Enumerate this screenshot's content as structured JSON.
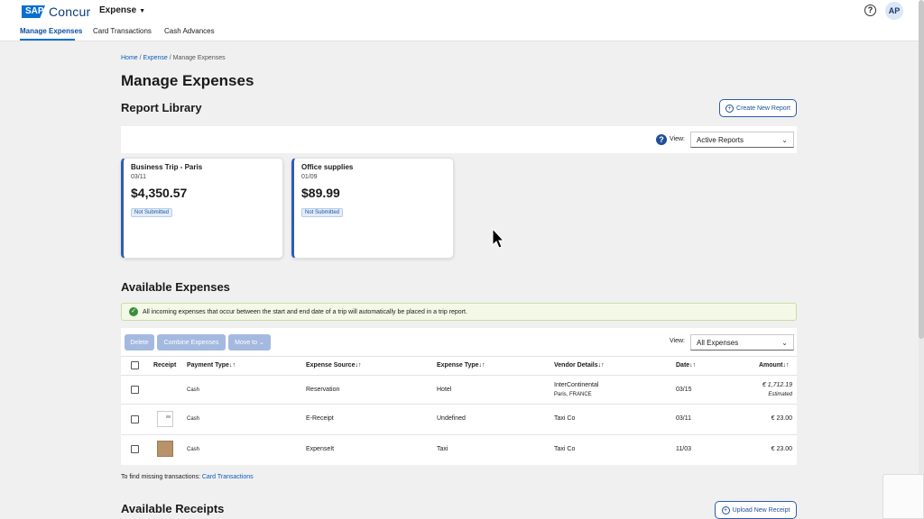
{
  "header": {
    "logo_sap": "SAP",
    "logo_concur": "Concur",
    "app_menu": "Expense",
    "help": "?",
    "avatar": "AP",
    "tabs": [
      {
        "label": "Manage Expenses"
      },
      {
        "label": "Card Transactions"
      },
      {
        "label": "Cash Advances"
      }
    ]
  },
  "breadcrumb": {
    "home": "Home",
    "sep1": " / ",
    "expense": "Expense",
    "sep2": " / ",
    "current": "Manage Expenses"
  },
  "page_title": "Manage Expenses",
  "report_library": {
    "title": "Report Library",
    "create_button": "Create New Report",
    "view_label": "View:",
    "view_value": "Active Reports",
    "reports": [
      {
        "name": "Business Trip - Paris",
        "date": "03/11",
        "amount": "$4,350.57",
        "status": "Not Submitted"
      },
      {
        "name": "Office supplies",
        "date": "01/09",
        "amount": "$89.99",
        "status": "Not Submitted"
      }
    ]
  },
  "available_expenses": {
    "title": "Available Expenses",
    "notice": "All incoming expenses that occur between the start and end date of a trip will automatically be placed in a trip report.",
    "buttons": {
      "delete": "Delete",
      "combine": "Combine Expenses",
      "move": "Move to"
    },
    "view_label": "View:",
    "view_value": "All Expenses",
    "columns": {
      "receipt": "Receipt",
      "payment_type": "Payment Type↓↑",
      "expense_source": "Expense Source↓↑",
      "expense_type": "Expense Type↓↑",
      "vendor": "Vendor Details↓↑",
      "date": "Date↓↑",
      "amount": "Amount↓↑"
    },
    "rows": [
      {
        "payment": "Cash",
        "source": "Reservation",
        "type": "Hotel",
        "vendor": "InterContinental",
        "vendor_sub": "Paris, FRANCE",
        "date": "03/15",
        "amount": "€ 1,712.19",
        "amount_note": "Estimated"
      },
      {
        "payment": "Cash",
        "source": "E-Receipt",
        "type": "Undefined",
        "vendor": "Taxi Co",
        "vendor_sub": "",
        "date": "03/11",
        "amount": "€ 23.00",
        "amount_note": ""
      },
      {
        "payment": "Cash",
        "source": "ExpenseIt",
        "type": "Taxi",
        "vendor": "Taxi Co",
        "vendor_sub": "",
        "date": "11/03",
        "amount": "€ 23.00",
        "amount_note": ""
      }
    ],
    "find_text": "To find missing transactions: ",
    "find_link": "Card Transactions"
  },
  "available_receipts": {
    "title": "Available Receipts",
    "upload_button": "Upload New Receipt"
  },
  "colors": {
    "brand": "#0a6ed1",
    "accent": "#2f5cb8",
    "notice_bg": "#f3f9e6",
    "button_disabled": "#a4b9e0"
  }
}
